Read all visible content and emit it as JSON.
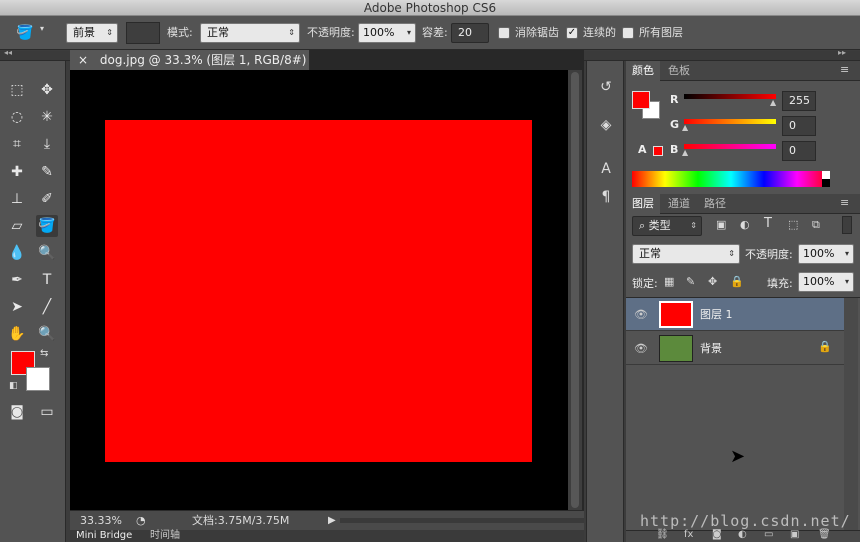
{
  "app": {
    "title": "Adobe Photoshop CS6"
  },
  "options_bar": {
    "fill_source": "前景",
    "mode_label": "模式:",
    "mode_value": "正常",
    "opacity_label": "不透明度:",
    "opacity_value": "100%",
    "tolerance_label": "容差:",
    "tolerance_value": "20",
    "anti_alias_label": "消除锯齿",
    "contiguous_label": "连续的",
    "all_layers_label": "所有图层",
    "anti_alias_checked": false,
    "contiguous_checked": true,
    "all_layers_checked": false
  },
  "document": {
    "tab_title": "dog.jpg @ 33.3% (图层 1, RGB/8#) *",
    "tab_close": "×",
    "zoom": "33.33%",
    "doc_size": "文档:3.75M/3.75M",
    "canvas_fill_color": "#ff0000"
  },
  "bottom_tabs": [
    "Mini Bridge",
    "时间轴"
  ],
  "color_panel": {
    "tabs": [
      "颜色",
      "色板"
    ],
    "r_label": "R",
    "g_label": "G",
    "b_label": "B",
    "r_value": "255",
    "g_value": "0",
    "b_value": "0",
    "foreground": "#ff0000",
    "background": "#ffffff"
  },
  "layers_panel": {
    "tabs": [
      "图层",
      "通道",
      "路径"
    ],
    "filter_kind": "类型",
    "blend_mode": "正常",
    "opacity_label": "不透明度:",
    "opacity_value": "100%",
    "lock_label": "锁定:",
    "fill_label": "填充:",
    "fill_value": "100%",
    "layers": [
      {
        "name": "图层 1",
        "selected": true,
        "locked": false
      },
      {
        "name": "背景",
        "selected": false,
        "locked": true
      }
    ]
  },
  "watermark": "http://blog.csdn.net/"
}
